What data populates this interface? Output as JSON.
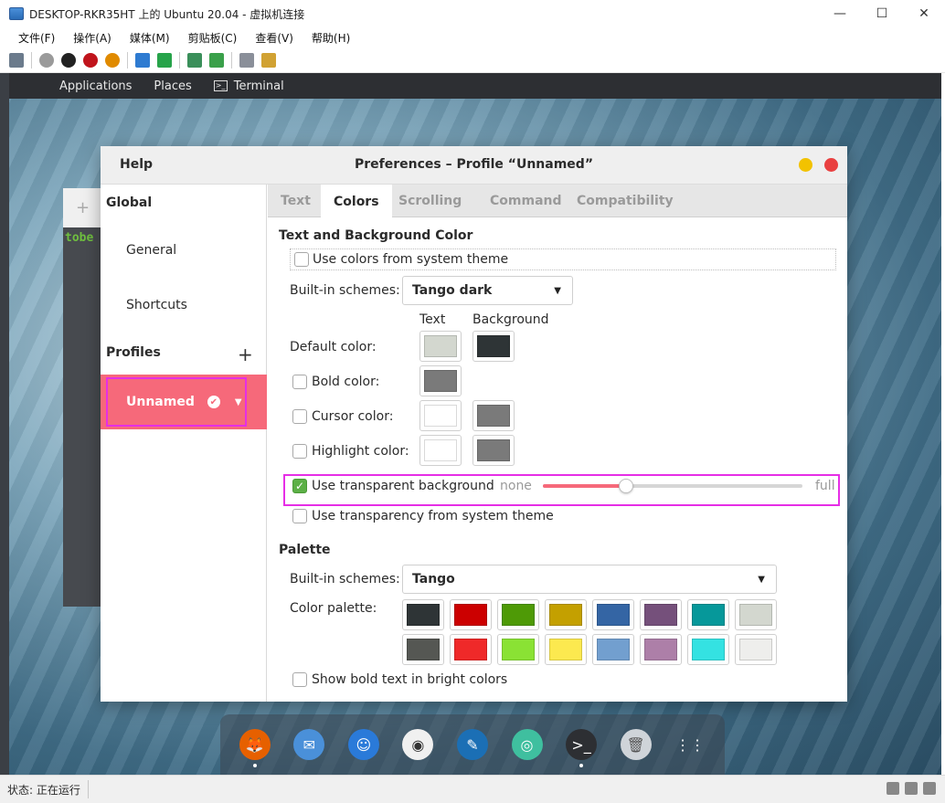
{
  "host": {
    "title": "DESKTOP-RKR35HT 上的 Ubuntu 20.04 - 虚拟机连接",
    "controls": {
      "minimize": "—",
      "maximize": "☐",
      "close": "✕"
    },
    "menu": [
      "文件(F)",
      "操作(A)",
      "媒体(M)",
      "剪贴板(C)",
      "查看(V)",
      "帮助(H)"
    ],
    "toolbar_icons": [
      "ctrl-alt-del-icon",
      "start-icon",
      "turnoff-icon",
      "shutdown-icon",
      "save-icon",
      "pause-icon",
      "resume-icon",
      "checkpoint-icon",
      "revert-icon",
      "enhanced-session-icon",
      "share-icon"
    ],
    "status": "状态: 正在运行"
  },
  "topbar": {
    "apple": "",
    "items": [
      "Applications",
      "Places",
      "Terminal"
    ]
  },
  "bg_terminal": {
    "plus": "+",
    "text": "tobe"
  },
  "dialog": {
    "help": "Help",
    "title": "Preferences – Profile “Unnamed”"
  },
  "sidebar": {
    "global_heading": "Global",
    "general": "General",
    "shortcuts": "Shortcuts",
    "profiles_heading": "Profiles",
    "add": "+",
    "profile_name": "Unnamed",
    "profile_check": "✔",
    "profile_drop": "▼"
  },
  "tabs": [
    "Text",
    "Colors",
    "Scrolling",
    "Command",
    "Compatibility"
  ],
  "active_tab": "Colors",
  "colors": {
    "section_title": "Text and Background Color",
    "use_system_theme": "Use colors from system theme",
    "builtin_label": "Built-in schemes:",
    "builtin_value": "Tango dark",
    "col_text": "Text",
    "col_background": "Background",
    "default_color": "Default color:",
    "bold_color": "Bold color:",
    "cursor_color": "Cursor color:",
    "highlight_color": "Highlight color:",
    "use_transparent": "Use transparent background",
    "transparent_checked": true,
    "none": "none",
    "full": "full",
    "transparency_level": 0.32,
    "use_transparency_system": "Use transparency from system theme",
    "swatches": {
      "default_text": "#d3d7cf",
      "default_bg": "#2e3436",
      "bold_text": "#7a7a7a",
      "cursor_text": "#ffffff",
      "cursor_bg": "#7a7a7a",
      "highlight_text": "#ffffff",
      "highlight_bg": "#7a7a7a"
    }
  },
  "palette": {
    "section_title": "Palette",
    "builtin_label": "Built-in schemes:",
    "builtin_value": "Tango",
    "color_palette_label": "Color palette:",
    "row1": [
      "#2e3436",
      "#cc0000",
      "#4e9a06",
      "#c4a000",
      "#3465a4",
      "#75507b",
      "#06989a",
      "#d3d7cf"
    ],
    "row2": [
      "#555753",
      "#ef2929",
      "#8ae234",
      "#fce94f",
      "#729fcf",
      "#ad7fa8",
      "#34e2e2",
      "#eeeeec"
    ],
    "bold_bright": "Show bold text in bright colors"
  },
  "dock": [
    "firefox-icon",
    "mail-icon",
    "finder-icon",
    "music-icon",
    "writer-icon",
    "help-icon",
    "terminal-icon",
    "trash-icon",
    "apps-grid-icon"
  ],
  "dock_glyphs": [
    "🦊",
    "✉",
    "☺",
    "◉",
    "✎",
    "◎",
    ">_",
    "🗑",
    "⋮⋮"
  ]
}
